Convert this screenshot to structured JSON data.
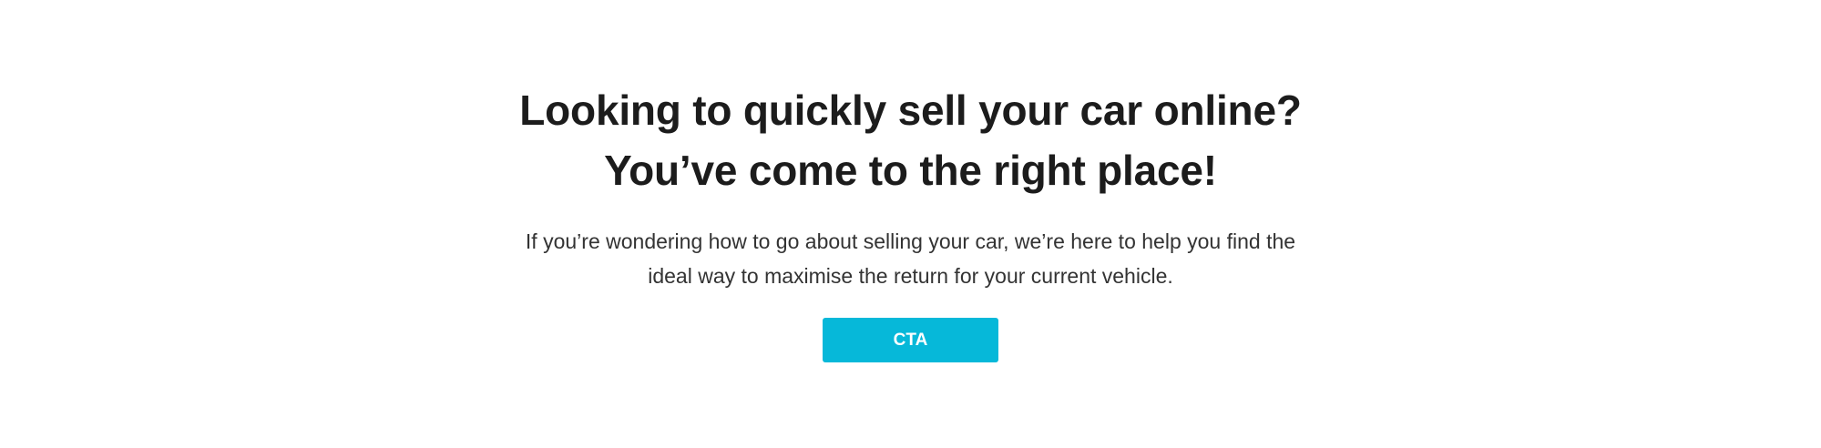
{
  "hero": {
    "title_line1": "Looking to quickly sell your car online?",
    "title_line2": "You’ve come to the right place!",
    "subtitle_line1": "If you’re wondering how to go about selling your car, we’re here to help you find the",
    "subtitle_line2": "ideal way to maximise the return for your current vehicle.",
    "cta_label": "CTA"
  },
  "colors": {
    "cta_background": "#06b8d9",
    "cta_text": "#ffffff",
    "heading_text": "#1c1c1c",
    "body_text": "#333333",
    "page_background": "#ffffff"
  }
}
